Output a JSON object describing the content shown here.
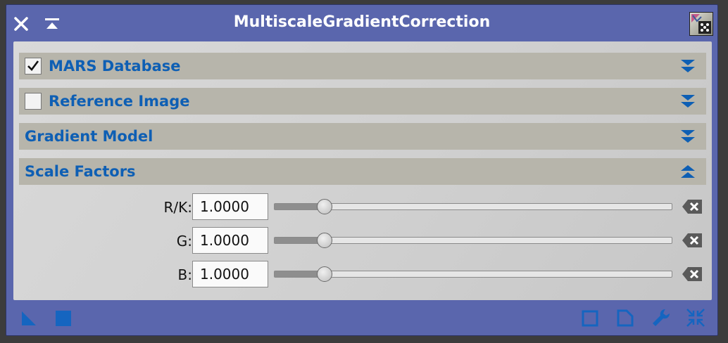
{
  "window": {
    "title": "MultiscaleGradientCorrection",
    "accent_color": "#5a66ad",
    "section_title_color": "#0e5fb4"
  },
  "titlebar_icons": [
    "close-icon",
    "shade-icon",
    "process-icon"
  ],
  "sections": [
    {
      "label": "MARS Database",
      "checkbox": true,
      "checked": true,
      "expanded": false
    },
    {
      "label": "Reference Image",
      "checkbox": true,
      "checked": false,
      "expanded": false
    },
    {
      "label": "Gradient Model",
      "checkbox": false,
      "expanded": false
    },
    {
      "label": "Scale Factors",
      "checkbox": false,
      "expanded": true
    }
  ],
  "scale_factors": [
    {
      "label": "R/K:",
      "value": "1.0000",
      "slider_fraction": 0.125
    },
    {
      "label": "G:",
      "value": "1.0000",
      "slider_fraction": 0.125
    },
    {
      "label": "B:",
      "value": "1.0000",
      "slider_fraction": 0.125
    }
  ],
  "bottom_icons": [
    "new-instance-icon",
    "execute-global-icon",
    "reset-icon",
    "browse-documentation-icon",
    "preferences-icon",
    "compact-gui-icon"
  ]
}
